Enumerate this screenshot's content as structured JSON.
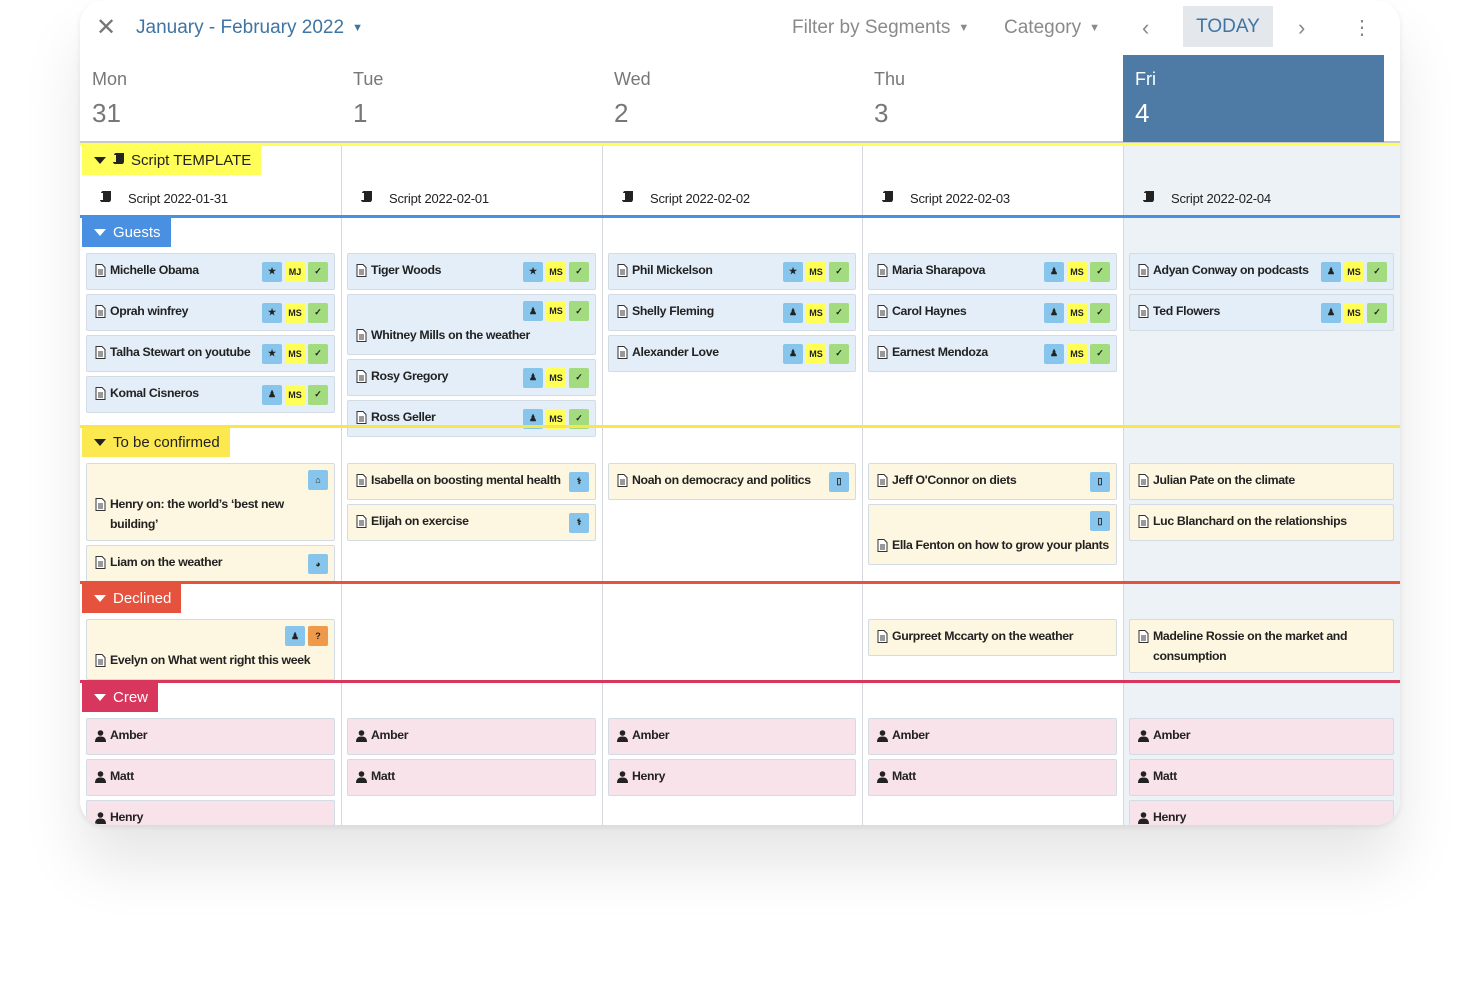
{
  "toolbar": {
    "close_icon": "close-icon",
    "range": "January - February 2022",
    "filter": "Filter by Segments",
    "category": "Category",
    "today": "TODAY",
    "prev_icon": "chevron-left-icon",
    "next_icon": "chevron-right-icon",
    "more_icon": "more-vertical-icon"
  },
  "days": [
    {
      "name": "Mon",
      "date": "31"
    },
    {
      "name": "Tue",
      "date": "1"
    },
    {
      "name": "Wed",
      "date": "2"
    },
    {
      "name": "Thu",
      "date": "3"
    },
    {
      "name": "Fri",
      "date": "4",
      "today": true
    }
  ],
  "colors": {
    "today": "#4d7ba6",
    "badge_blue": "#87c5ec",
    "badge_yellow": "#ffff55",
    "badge_green": "#a2dc7f",
    "badge_orange": "#ef9a4a"
  },
  "sections": [
    {
      "label": "Script TEMPLATE",
      "type": "script",
      "color": "#ffff57",
      "text_color": "#222",
      "line": "#ffff57",
      "bg": "",
      "days": [
        [
          "Script 2022-01-31"
        ],
        [
          "Script 2022-02-01"
        ],
        [
          "Script 2022-02-02"
        ],
        [
          "Script 2022-02-03"
        ],
        [
          "Script 2022-02-04"
        ]
      ]
    },
    {
      "label": "Guests",
      "type": "cards",
      "color": "#4a90e2",
      "text_color": "#fff",
      "line": "#4a90e2",
      "bg": "#e4eef9",
      "days": [
        [
          {
            "title": "Michelle Obama",
            "badges": [
              "star",
              "MJ",
              "check"
            ]
          },
          {
            "title": "Oprah winfrey",
            "badges": [
              "star",
              "MS",
              "check"
            ]
          },
          {
            "title": "Talha Stewart on youtube",
            "badges": [
              "star",
              "MS",
              "check"
            ]
          },
          {
            "title": "Komal Cisneros",
            "badges": [
              "person",
              "MS",
              "check"
            ]
          }
        ],
        [
          {
            "title": "Tiger Woods",
            "badges": [
              "star",
              "MS",
              "check"
            ]
          },
          {
            "title": "Whitney Mills on the weather",
            "badges": [
              "person",
              "MS",
              "check"
            ]
          },
          {
            "title": "Rosy Gregory",
            "badges": [
              "person",
              "MS",
              "check"
            ]
          },
          {
            "title": "Ross Geller",
            "badges": [
              "person",
              "MS",
              "check"
            ]
          }
        ],
        [
          {
            "title": "Phil Mickelson",
            "badges": [
              "star",
              "MS",
              "check"
            ]
          },
          {
            "title": "Shelly Fleming",
            "badges": [
              "person",
              "MS",
              "check"
            ]
          },
          {
            "title": "Alexander Love",
            "badges": [
              "person",
              "MS",
              "check"
            ]
          }
        ],
        [
          {
            "title": "Maria Sharapova",
            "badges": [
              "person",
              "MS",
              "check"
            ]
          },
          {
            "title": "Carol Haynes",
            "badges": [
              "person",
              "MS",
              "check"
            ]
          },
          {
            "title": "Earnest Mendoza",
            "badges": [
              "person",
              "MS",
              "check"
            ]
          }
        ],
        [
          {
            "title": "Adyan Conway on podcasts",
            "badges": [
              "person",
              "MS",
              "check"
            ]
          },
          {
            "title": "Ted Flowers",
            "badges": [
              "person",
              "MS",
              "check"
            ]
          }
        ]
      ]
    },
    {
      "label": "To be confirmed",
      "type": "cards",
      "color": "#fbe94f",
      "text_color": "#222",
      "line": "#f9e64a",
      "bg": "#fdf6e0",
      "days": [
        [
          {
            "title": "Henry on: the world’s ‘best new building’",
            "badges": [
              "bank"
            ]
          },
          {
            "title": "Liam on the weather",
            "badges": [
              "globe"
            ]
          }
        ],
        [
          {
            "title": "Isabella on boosting mental health",
            "badges": [
              "stethoscope"
            ]
          },
          {
            "title": "Elijah on exercise",
            "badges": [
              "stethoscope"
            ]
          }
        ],
        [
          {
            "title": "Noah on democracy and politics",
            "badges": [
              "book"
            ]
          }
        ],
        [
          {
            "title": "Jeff O'Connor on diets",
            "badges": [
              "book"
            ]
          },
          {
            "title": "Ella Fenton on how to grow your plants",
            "badges": [
              "book"
            ]
          }
        ],
        [
          {
            "title": "Julian Pate on the climate",
            "badges": []
          },
          {
            "title": "Luc Blanchard on the relationships",
            "badges": []
          }
        ]
      ]
    },
    {
      "label": "Declined",
      "type": "cards",
      "color": "#e5533f",
      "text_color": "#fff",
      "line": "#e5533f",
      "bg": "#fdf6e0",
      "days": [
        [
          {
            "title": "Evelyn on What went right this week",
            "badges": [
              "person",
              "?"
            ]
          }
        ],
        [],
        [],
        [
          {
            "title": "Gurpreet Mccarty on the weather",
            "badges": []
          }
        ],
        [
          {
            "title": "Madeline Rossie on the market and consumption",
            "badges": []
          }
        ]
      ]
    },
    {
      "label": "Crew",
      "type": "crew",
      "color": "#d9365e",
      "text_color": "#fff",
      "line": "#d9365e",
      "bg": "#f9e3ea",
      "days": [
        [
          "Amber",
          "Matt",
          "Henry"
        ],
        [
          "Amber",
          "Matt"
        ],
        [
          "Amber",
          "Henry"
        ],
        [
          "Amber",
          "Matt"
        ],
        [
          "Amber",
          "Matt",
          "Henry"
        ]
      ]
    }
  ]
}
